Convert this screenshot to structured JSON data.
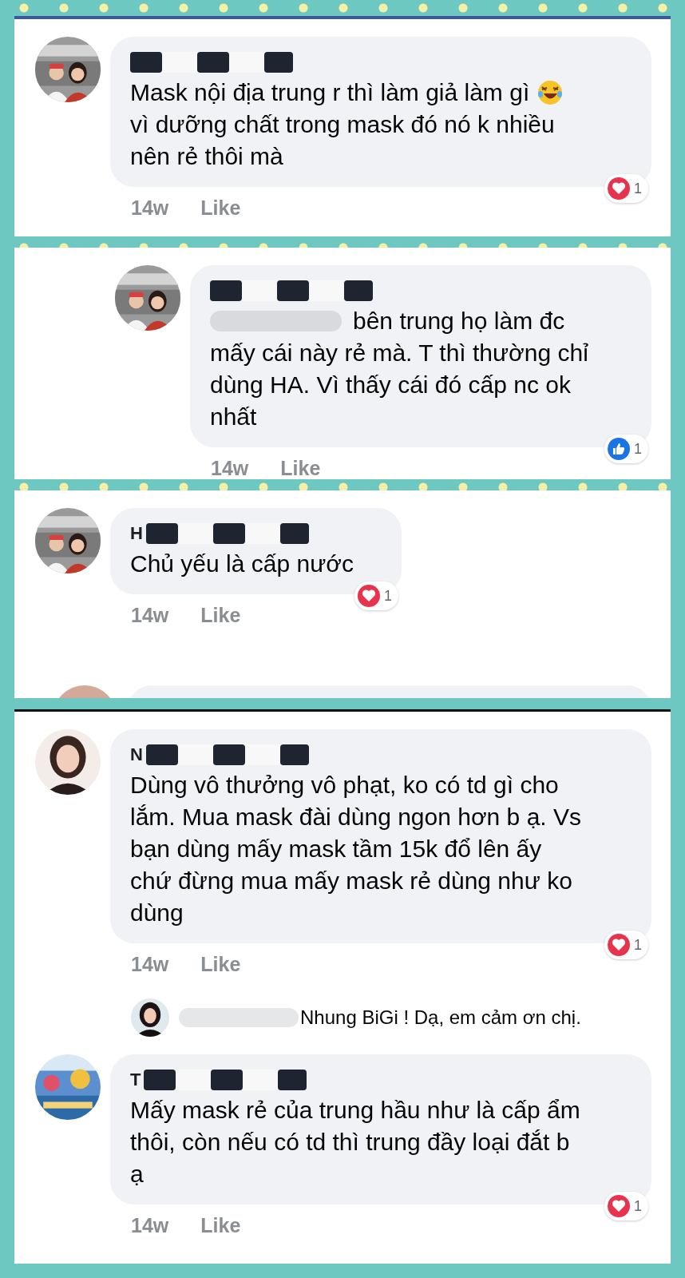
{
  "panels": [
    {
      "comments": [
        {
          "kind": "comment",
          "lines": [
            {
              "kind": "emoji_after",
              "text": "Mask nội địa trung r thì làm giả làm gì"
            },
            {
              "kind": "plain",
              "text": "vì dưỡng chất trong mask đó nó k nhiều"
            },
            {
              "kind": "plain",
              "text": "nên rẻ thôi mà"
            }
          ],
          "time": "14w",
          "like": "Like",
          "reaction": {
            "kind": "love",
            "count": "1"
          }
        }
      ]
    },
    {
      "comments": [
        {
          "kind": "reply",
          "lines": [
            {
              "kind": "after_redacted",
              "text": "bên trung họ làm đc"
            },
            {
              "kind": "plain",
              "text": "mấy cái này rẻ mà. T thì thường chỉ"
            },
            {
              "kind": "plain",
              "text": "dùng HA. Vì thấy cái đó cấp nc ok"
            },
            {
              "kind": "plain",
              "text": "nhất"
            }
          ],
          "time": "14w",
          "like": "Like",
          "reaction": {
            "kind": "like",
            "count": "1"
          }
        }
      ]
    },
    {
      "comments": [
        {
          "kind": "comment",
          "name_initial": "H",
          "lines": [
            {
              "kind": "plain",
              "text": "Chủ yếu là cấp nước"
            }
          ],
          "time": "14w",
          "like": "Like",
          "reaction": {
            "kind": "love",
            "count": "1"
          }
        },
        {
          "kind": "cut"
        }
      ]
    },
    {
      "comments": [
        {
          "kind": "comment",
          "name_initial": "N",
          "lines": [
            {
              "kind": "plain",
              "text": "Dùng vô thưởng vô phạt, ko có td gì cho"
            },
            {
              "kind": "plain",
              "text": "lắm. Mua mask đài dùng ngon hơn b ạ. Vs"
            },
            {
              "kind": "plain",
              "text": "bạn dùng mấy mask tầm 15k đổ lên ấy"
            },
            {
              "kind": "plain",
              "text": "chứ đừng mua mấy mask rẻ dùng như ko"
            },
            {
              "kind": "plain",
              "text": "dùng"
            }
          ],
          "time": "14w",
          "like": "Like",
          "reaction": {
            "kind": "love",
            "count": "1"
          }
        },
        {
          "kind": "reply_line",
          "text": "Nhung BiGi ! Dạ, em cảm ơn chị."
        },
        {
          "kind": "comment",
          "name_initial": "T",
          "lines": [
            {
              "kind": "plain",
              "text": "Mấy mask rẻ của trung hầu như là cấp ẩm"
            },
            {
              "kind": "plain",
              "text": "thôi, còn nếu có td thì trung đầy loại đắt b"
            },
            {
              "kind": "plain",
              "text": "ạ"
            }
          ],
          "time": "14w",
          "like": "Like",
          "reaction": {
            "kind": "love",
            "count": "1"
          }
        }
      ]
    }
  ]
}
